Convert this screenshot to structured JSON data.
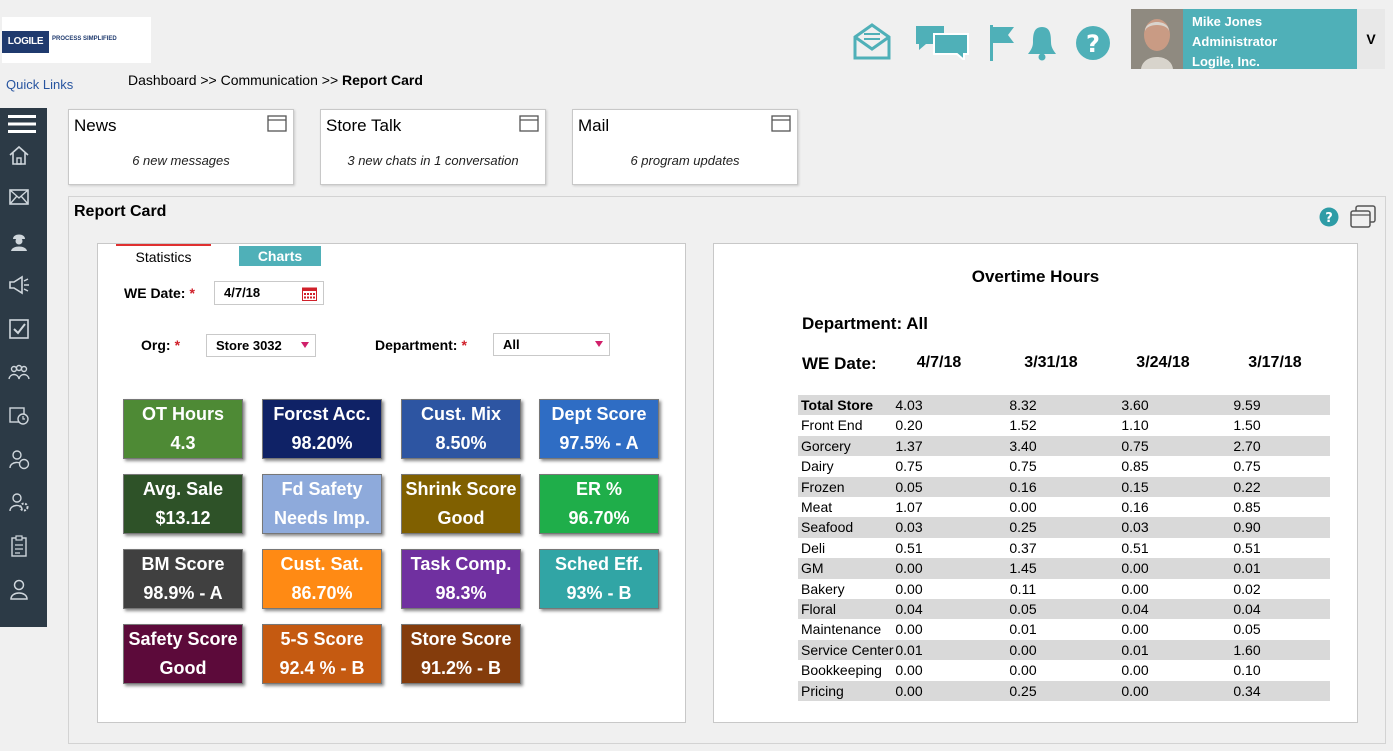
{
  "logo": {
    "brand": "LOGILE",
    "tagline": "PROCESS SIMPLIFIED"
  },
  "quick_links": "Quick Links",
  "breadcrumb": {
    "part1": "Dashboard >> Communication >> ",
    "current": "Report Card"
  },
  "header_icons": [
    "mail-envelope-icon",
    "chat-bubbles-icon",
    "flag-icon",
    "bell-icon",
    "help-icon"
  ],
  "user": {
    "name": "Mike Jones",
    "role": "Administrator",
    "company": "Logile, Inc.",
    "menu_label": "V"
  },
  "sidebar_icons": [
    "menu-icon",
    "home-icon",
    "mail-icon",
    "worker-icon",
    "megaphone-icon",
    "checkbox-icon",
    "team-icon",
    "schedule-clock-icon",
    "user-clock-icon",
    "user-settings-icon",
    "clipboard-icon",
    "profile-icon"
  ],
  "cards": [
    {
      "title": "News",
      "message": "6 new messages"
    },
    {
      "title": "Store Talk",
      "message": "3 new chats in 1 conversation"
    },
    {
      "title": "Mail",
      "message": "6 program updates"
    }
  ],
  "report": {
    "title": "Report Card",
    "tabs": {
      "statistics": "Statistics",
      "charts": "Charts"
    },
    "we_date": {
      "label": "WE Date:",
      "value": "4/7/18"
    },
    "org": {
      "label": "Org:",
      "value": "Store 3032"
    },
    "department": {
      "label": "Department:",
      "value": "All"
    },
    "required_mark": "*",
    "tiles": [
      {
        "line1": "OT Hours",
        "line2": "4.3",
        "color": "#4e8a35"
      },
      {
        "line1": "Forcst Acc.",
        "line2": "98.20%",
        "color": "#0f2266"
      },
      {
        "line1": "Cust. Mix",
        "line2": "8.50%",
        "color": "#2d55a2"
      },
      {
        "line1": "Dept Score",
        "line2": "97.5% - A",
        "color": "#2f6dc4"
      },
      {
        "line1": "Avg. Sale",
        "line2": "$13.12",
        "color": "#2e5228"
      },
      {
        "line1": "Fd Safety",
        "line2": "Needs Imp.",
        "color": "#8eaadb"
      },
      {
        "line1": "Shrink Score",
        "line2": "Good",
        "color": "#806000"
      },
      {
        "line1": "ER %",
        "line2": "96.70%",
        "color": "#1fae4a"
      },
      {
        "line1": "BM Score",
        "line2": "98.9% - A",
        "color": "#404040"
      },
      {
        "line1": "Cust. Sat.",
        "line2": "86.70%",
        "color": "#ff8a14"
      },
      {
        "line1": "Task Comp.",
        "line2": "98.3%",
        "color": "#7030a0"
      },
      {
        "line1": "Sched Eff.",
        "line2": "93% - B",
        "color": "#31a5a5"
      },
      {
        "line1": "Safety Score",
        "line2": "Good",
        "color": "#5c0a3a"
      },
      {
        "line1": "5-S Score",
        "line2": "92.4 % - B",
        "color": "#c55a11"
      },
      {
        "line1": "Store Score",
        "line2": "91.2% - B",
        "color": "#843c0c"
      }
    ]
  },
  "overtime": {
    "title": "Overtime Hours",
    "department_label": "Department: All",
    "we_label": "WE Date:",
    "dates": [
      "4/7/18",
      "3/31/18",
      "3/24/18",
      "3/17/18"
    ],
    "rows": [
      {
        "name": "Total Store",
        "values": [
          "4.03",
          "8.32",
          "3.60",
          "9.59"
        ],
        "bold": true
      },
      {
        "name": "Front End",
        "values": [
          "0.20",
          "1.52",
          "1.10",
          "1.50"
        ]
      },
      {
        "name": "Gorcery",
        "values": [
          "1.37",
          "3.40",
          "0.75",
          "2.70"
        ]
      },
      {
        "name": "Dairy",
        "values": [
          "0.75",
          "0.75",
          "0.85",
          "0.75"
        ]
      },
      {
        "name": "Frozen",
        "values": [
          "0.05",
          "0.16",
          "0.15",
          "0.22"
        ]
      },
      {
        "name": "Meat",
        "values": [
          "1.07",
          "0.00",
          "0.16",
          "0.85"
        ]
      },
      {
        "name": "Seafood",
        "values": [
          "0.03",
          "0.25",
          "0.03",
          "0.90"
        ]
      },
      {
        "name": "Deli",
        "values": [
          "0.51",
          "0.37",
          "0.51",
          "0.51"
        ]
      },
      {
        "name": "GM",
        "values": [
          "0.00",
          "1.45",
          "0.00",
          "0.01"
        ]
      },
      {
        "name": "Bakery",
        "values": [
          "0.00",
          "0.11",
          "0.00",
          "0.02"
        ]
      },
      {
        "name": "Floral",
        "values": [
          "0.04",
          "0.05",
          "0.04",
          "0.04"
        ]
      },
      {
        "name": "Maintenance",
        "values": [
          "0.00",
          "0.01",
          "0.00",
          "0.05"
        ]
      },
      {
        "name": "Service Center",
        "values": [
          "0.01",
          "0.00",
          "0.01",
          "1.60"
        ]
      },
      {
        "name": "Bookkeeping",
        "values": [
          "0.00",
          "0.00",
          "0.00",
          "0.10"
        ]
      },
      {
        "name": "Pricing",
        "values": [
          "0.00",
          "0.25",
          "0.00",
          "0.34"
        ]
      }
    ]
  },
  "colors": {
    "accent": "#4fb0b8",
    "sidebar": "#2c3a46",
    "required": "#d0202a"
  }
}
